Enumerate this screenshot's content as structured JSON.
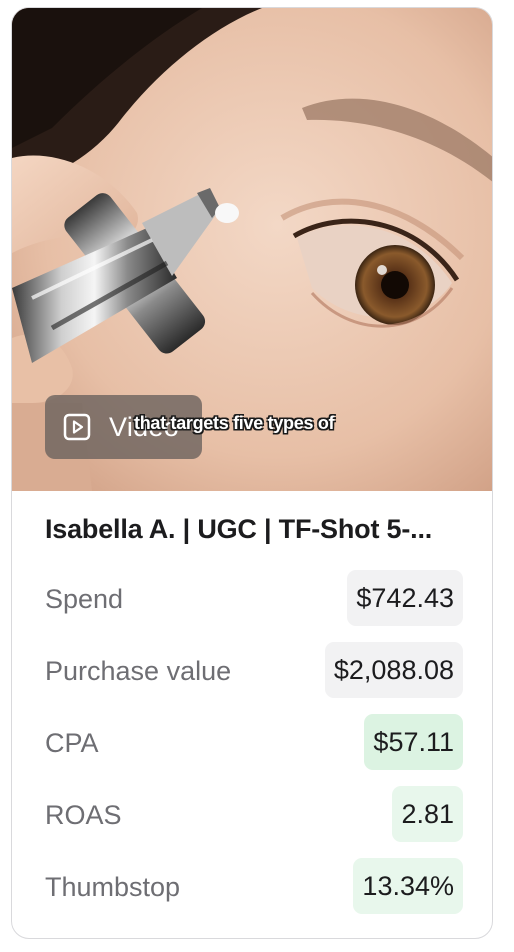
{
  "media": {
    "badge_label": "Video",
    "badge_icon": "play-square-icon",
    "caption": "that targets five types of"
  },
  "ad": {
    "title": "Isabella A. | UGC | TF-Shot 5-..."
  },
  "metrics": [
    {
      "label": "Spend",
      "value": "$742.43",
      "tone": "neutral"
    },
    {
      "label": "Purchase value",
      "value": "$2,088.08",
      "tone": "neutral"
    },
    {
      "label": "CPA",
      "value": "$57.11",
      "tone": "green"
    },
    {
      "label": "ROAS",
      "value": "2.81",
      "tone": "green-light"
    },
    {
      "label": "Thumbstop",
      "value": "13.34%",
      "tone": "green-light"
    }
  ],
  "colors": {
    "neutral_pill": "#f2f2f3",
    "green_pill": "#dcf3e2",
    "green_light_pill": "#e8f7ec",
    "label_text": "#6e6e73",
    "value_text": "#1c1c1e"
  }
}
